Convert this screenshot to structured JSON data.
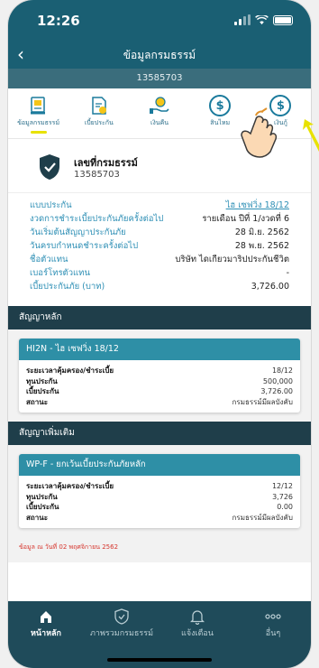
{
  "status": {
    "time": "12:26"
  },
  "nav": {
    "title": "ข้อมูลกรมธรรม์",
    "subtitle": "13585703"
  },
  "tabs": [
    {
      "label": "ข้อมูลกรมธรรม์",
      "icon": "policy-document-icon"
    },
    {
      "label": "เบี้ยประกัน",
      "icon": "premium-receipt-icon"
    },
    {
      "label": "เงินคืน",
      "icon": "hand-coin-icon"
    },
    {
      "label": "สินไหม",
      "icon": "dollar-coin-icon"
    },
    {
      "label": "เงินกู้",
      "icon": "dollar-coin-icon"
    }
  ],
  "policy": {
    "label": "เลขที่กรมธรรม์",
    "number": "13585703",
    "rows": [
      {
        "key": "แบบประกัน",
        "value": "ไฮ เซฟวิ่ง 18/12"
      },
      {
        "key": "งวดการชำระเบี้ยประกันภัยครั้งต่อไป",
        "value": "รายเดือน ปีที่ 1/งวดที่ 6"
      },
      {
        "key": "วันเริ่มต้นสัญญาประกันภัย",
        "value": "28 มิ.ย. 2562"
      },
      {
        "key": "วันครบกำหนดชำระครั้งต่อไป",
        "value": "28 พ.ย. 2562"
      },
      {
        "key": "ชื่อตัวแทน",
        "value": "บริษัท ไดเกียวมาริปประกันชีวิต"
      },
      {
        "key": "เบอร์โทรตัวแทน",
        "value": "-"
      },
      {
        "key": "เบี้ยประกันภัย (บาท)",
        "value": "3,726.00"
      }
    ]
  },
  "main_contract": {
    "header": "สัญญาหลัก",
    "title": "HI2N - ไฮ เซฟวิ่ง 18/12",
    "rows": [
      {
        "key": "ระยะเวลาคุ้มครอง/ชำระเบี้ย",
        "value": "18/12"
      },
      {
        "key": "ทุนประกัน",
        "value": "500,000"
      },
      {
        "key": "เบี้ยประกัน",
        "value": "3,726.00"
      },
      {
        "key": "สถานะ",
        "value": "กรมธรรม์มีผลบังคับ"
      }
    ]
  },
  "rider": {
    "header": "สัญญาเพิ่มเติม",
    "title": "WP-F - ยกเว้นเบี้ยประกันภัยหลัก",
    "rows": [
      {
        "key": "ระยะเวลาคุ้มครอง/ชำระเบี้ย",
        "value": "12/12"
      },
      {
        "key": "ทุนประกัน",
        "value": "3,726"
      },
      {
        "key": "เบี้ยประกัน",
        "value": "0.00"
      },
      {
        "key": "สถานะ",
        "value": "กรมธรรม์มีผลบังคับ"
      }
    ]
  },
  "footnote": "ข้อมูล ณ วันที่ 02 พฤศจิกายน 2562",
  "bottom_nav": [
    {
      "label": "หน้าหลัก",
      "icon": "home-icon"
    },
    {
      "label": "ภาพรวมกรมธรรม์",
      "icon": "shield-check-icon"
    },
    {
      "label": "แจ้งเตือน",
      "icon": "bell-icon"
    },
    {
      "label": "อื่นๆ",
      "icon": "more-icon"
    }
  ],
  "colors": {
    "header": "#1a5f73",
    "accent": "#2e8fb5",
    "section": "#1f3e4a",
    "card_title": "#2e8fa6",
    "bottom_nav": "#1f4b5a",
    "highlight": "#e8e200"
  }
}
